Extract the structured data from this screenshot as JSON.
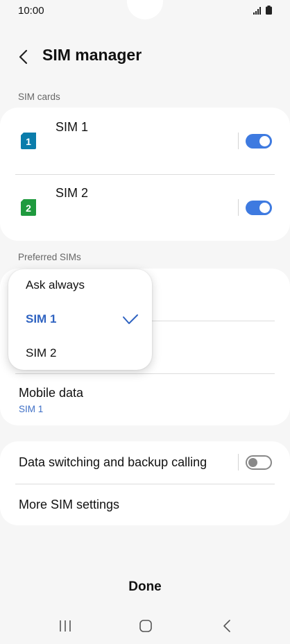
{
  "status_bar": {
    "time": "10:00"
  },
  "header": {
    "title": "SIM manager"
  },
  "sim_cards": {
    "section_label": "SIM cards",
    "items": [
      {
        "icon_text": "1",
        "name": "SIM 1",
        "enabled": true,
        "icon_color": "#0b7dab"
      },
      {
        "icon_text": "2",
        "name": "SIM 2",
        "enabled": true,
        "icon_color": "#1f9a3e"
      }
    ]
  },
  "preferred_sims": {
    "section_label": "Preferred SIMs",
    "mobile_data": {
      "label": "Mobile data",
      "value": "SIM 1"
    }
  },
  "popup_menu": {
    "options": [
      "Ask always",
      "SIM 1",
      "SIM 2"
    ],
    "selected": "SIM 1"
  },
  "more": {
    "data_switching_label": "Data switching and backup calling",
    "data_switching_enabled": false,
    "more_settings_label": "More SIM settings"
  },
  "footer": {
    "done_label": "Done"
  },
  "colors": {
    "accent": "#3e7ae0",
    "background": "#f6f6f6",
    "card": "#ffffff"
  }
}
